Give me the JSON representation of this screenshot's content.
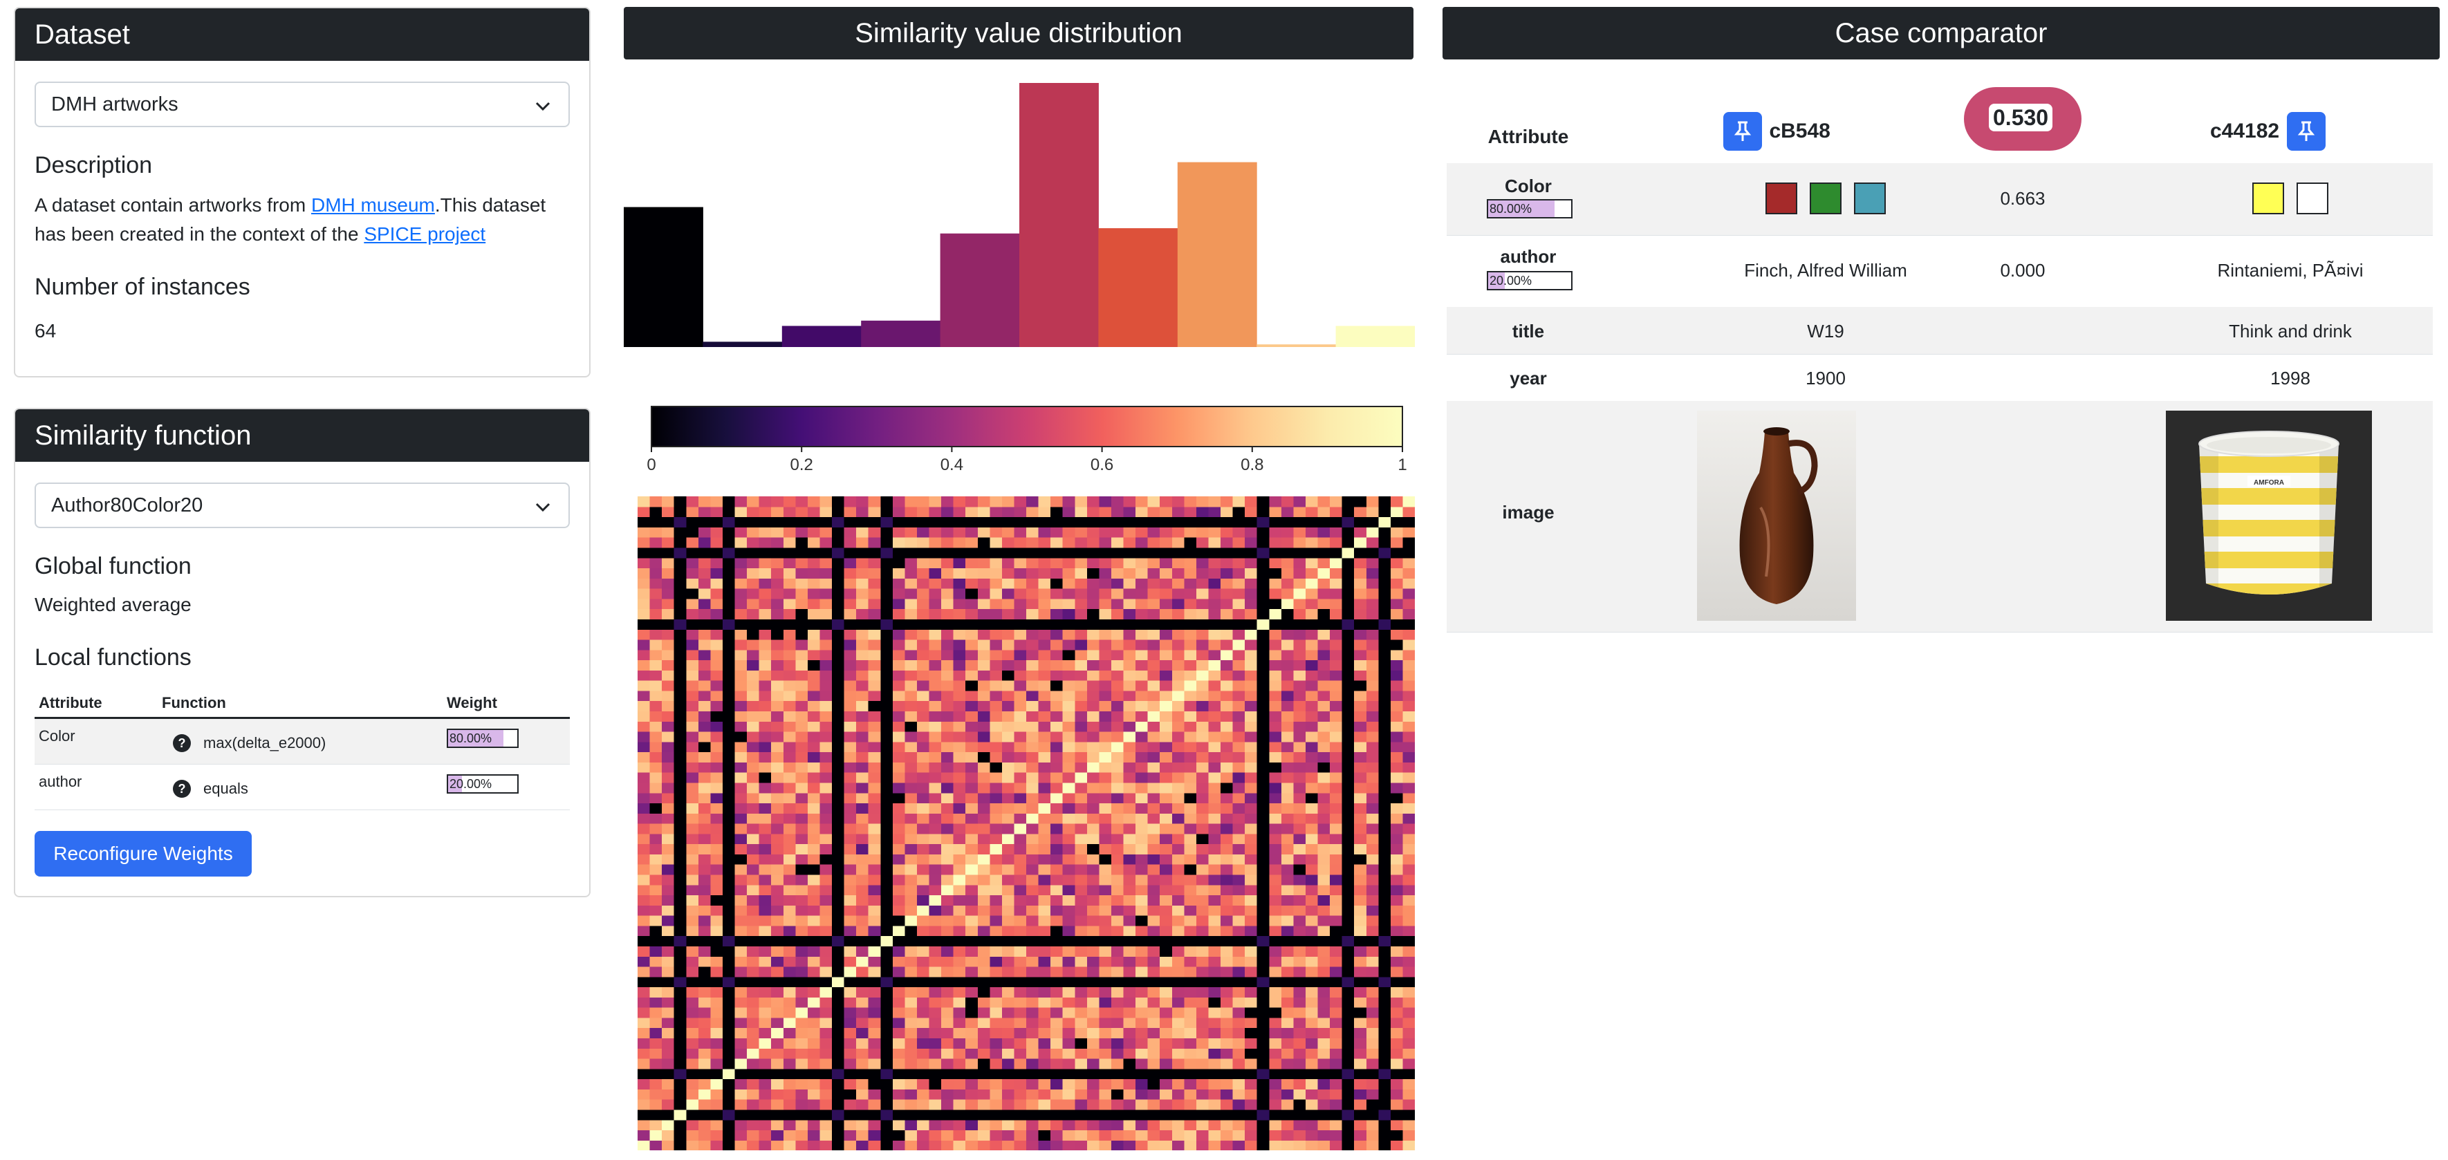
{
  "dataset": {
    "header": "Dataset",
    "selected": "DMH artworks",
    "description_title": "Description",
    "description_text_1": "A dataset contain artworks from ",
    "description_link_1": "DMH museum",
    "description_text_2": ".This dataset has been created in the context of the ",
    "description_link_2": "SPICE project",
    "instances_title": "Number of instances",
    "instances_value": "64"
  },
  "similarity": {
    "header": "Similarity function",
    "selected": "Author80Color20",
    "global_title": "Global function",
    "global_value": "Weighted average",
    "local_title": "Local functions",
    "columns": [
      "Attribute",
      "Function",
      "Weight"
    ],
    "rows": [
      {
        "attribute": "Color",
        "function": "max(delta_e2000)",
        "weight": "80.00%",
        "weight_value": 0.8
      },
      {
        "attribute": "author",
        "function": "equals",
        "weight": "20.00%",
        "weight_value": 0.2
      }
    ],
    "help_glyph": "?",
    "button": "Reconfigure Weights"
  },
  "distribution": {
    "header": "Similarity value distribution"
  },
  "chart_data": [
    {
      "type": "bar",
      "title": "Similarity value distribution",
      "bins": [
        0.05,
        0.15,
        0.25,
        0.35,
        0.45,
        0.55,
        0.65,
        0.75,
        0.85,
        0.95
      ],
      "values": [
        0.53,
        0.02,
        0.08,
        0.1,
        0.43,
        1.0,
        0.45,
        0.7,
        0.01,
        0.08
      ],
      "colors": [
        "#000004",
        "#160b39",
        "#420a68",
        "#6a176e",
        "#932667",
        "#bc3754",
        "#dd513a",
        "#f1975a",
        "#fcc98a",
        "#fcfdbf"
      ],
      "ylim": [
        0,
        1
      ]
    },
    {
      "type": "heatmap",
      "colorbar_ticks": [
        "0",
        "0.2",
        "0.4",
        "0.6",
        "0.8",
        "1"
      ],
      "colormap": "magma",
      "size": 64,
      "black_rows": [
        3,
        7,
        16,
        20,
        51,
        58,
        61
      ],
      "diag_value": 1.0
    }
  ],
  "comparator": {
    "header": "Case comparator",
    "score": "0.530",
    "col_attribute": "Attribute",
    "left_case": "cB548",
    "right_case": "c44182",
    "rows": [
      {
        "attribute": "Color",
        "weight": "80.00%",
        "weight_value": 0.8,
        "left_colors": [
          "#a52a2a",
          "#2e8b2e",
          "#4aa0b5"
        ],
        "sim": "0.663",
        "right_colors": [
          "#ffff55",
          "#ffffff"
        ]
      },
      {
        "attribute": "author",
        "weight": "20.00%",
        "weight_value": 0.2,
        "left": "Finch, Alfred William",
        "sim": "0.000",
        "right": "Rintaniemi, PÃ¤ivi"
      },
      {
        "attribute": "title",
        "left": "W19",
        "sim": "",
        "right": "Think and drink"
      },
      {
        "attribute": "year",
        "left": "1900",
        "sim": "",
        "right": "1998"
      },
      {
        "attribute": "image",
        "left_image": "brown-vase-image",
        "right_image": "yellow-cup-image",
        "cup_label": "AMFORA"
      }
    ],
    "score_color": "#c74a70"
  }
}
